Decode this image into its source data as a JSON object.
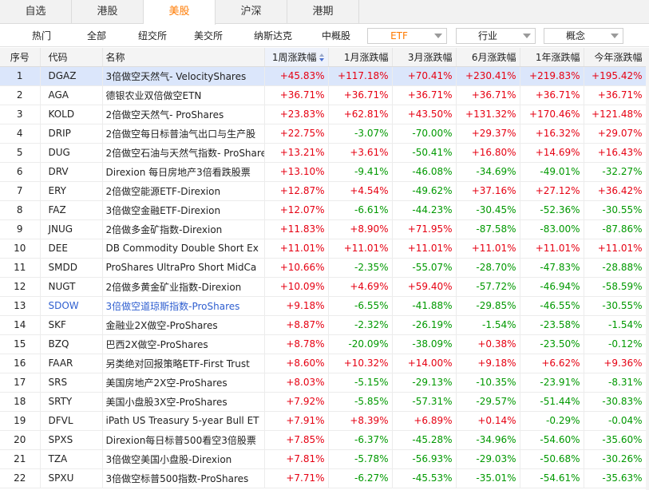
{
  "market_tabs": [
    {
      "label": "自选",
      "active": false
    },
    {
      "label": "港股",
      "active": false
    },
    {
      "label": "美股",
      "active": true
    },
    {
      "label": "沪深",
      "active": false
    },
    {
      "label": "港期",
      "active": false
    }
  ],
  "categories": [
    "热门",
    "全部",
    "纽交所",
    "美交所",
    "纳斯达克",
    "中概股"
  ],
  "dropdowns": {
    "etf": "ETF",
    "industry": "行业",
    "concept": "概念"
  },
  "columns": {
    "idx": "序号",
    "code": "代码",
    "name": "名称",
    "w1": "1周涨跌幅",
    "m1": "1月涨跌幅",
    "m3": "3月涨跌幅",
    "m6": "6月涨跌幅",
    "y1": "1年涨跌幅",
    "ytd": "今年涨跌幅"
  },
  "colors": {
    "up": "#e60012",
    "down": "#009900",
    "accent": "#ff7a00",
    "link": "#2f5fd0",
    "selected_row": "#dbe6fb"
  },
  "rows": [
    {
      "idx": "1",
      "code": "DGAZ",
      "name": "3倍做空天然气- VelocityShares",
      "w1": "+45.83%",
      "m1": "+117.18%",
      "m3": "+70.41%",
      "m6": "+230.41%",
      "y1": "+219.83%",
      "ytd": "+195.42%",
      "selected": true
    },
    {
      "idx": "2",
      "code": "AGA",
      "name": "德银农业双倍做空ETN",
      "w1": "+36.71%",
      "m1": "+36.71%",
      "m3": "+36.71%",
      "m6": "+36.71%",
      "y1": "+36.71%",
      "ytd": "+36.71%"
    },
    {
      "idx": "3",
      "code": "KOLD",
      "name": "2倍做空天然气- ProShares",
      "w1": "+23.83%",
      "m1": "+62.81%",
      "m3": "+43.50%",
      "m6": "+131.32%",
      "y1": "+170.46%",
      "ytd": "+121.48%"
    },
    {
      "idx": "4",
      "code": "DRIP",
      "name": "2倍做空每日标普油气出口与生产股",
      "w1": "+22.75%",
      "m1": "-3.07%",
      "m3": "-70.00%",
      "m6": "+29.37%",
      "y1": "+16.32%",
      "ytd": "+29.07%"
    },
    {
      "idx": "5",
      "code": "DUG",
      "name": "2倍做空石油与天然气指数- ProShares",
      "w1": "+13.21%",
      "m1": "+3.61%",
      "m3": "-50.41%",
      "m6": "+16.80%",
      "y1": "+14.69%",
      "ytd": "+16.43%"
    },
    {
      "idx": "6",
      "code": "DRV",
      "name": "Direxion 每日房地产3倍看跌股票",
      "w1": "+13.10%",
      "m1": "-9.41%",
      "m3": "-46.08%",
      "m6": "-34.69%",
      "y1": "-49.01%",
      "ytd": "-32.27%"
    },
    {
      "idx": "7",
      "code": "ERY",
      "name": "2倍做空能源ETF-Direxion",
      "w1": "+12.87%",
      "m1": "+4.54%",
      "m3": "-49.62%",
      "m6": "+37.16%",
      "y1": "+27.12%",
      "ytd": "+36.42%"
    },
    {
      "idx": "8",
      "code": "FAZ",
      "name": "3倍做空金融ETF-Direxion",
      "w1": "+12.07%",
      "m1": "-6.61%",
      "m3": "-44.23%",
      "m6": "-30.45%",
      "y1": "-52.36%",
      "ytd": "-30.55%"
    },
    {
      "idx": "9",
      "code": "JNUG",
      "name": "2倍做多金矿指数-Direxion",
      "w1": "+11.83%",
      "m1": "+8.90%",
      "m3": "+71.95%",
      "m6": "-87.58%",
      "y1": "-83.00%",
      "ytd": "-87.86%"
    },
    {
      "idx": "10",
      "code": "DEE",
      "name": "DB Commodity Double Short Ex",
      "w1": "+11.01%",
      "m1": "+11.01%",
      "m3": "+11.01%",
      "m6": "+11.01%",
      "y1": "+11.01%",
      "ytd": "+11.01%"
    },
    {
      "idx": "11",
      "code": "SMDD",
      "name": "ProShares UltraPro Short MidCa",
      "w1": "+10.66%",
      "m1": "-2.35%",
      "m3": "-55.07%",
      "m6": "-28.70%",
      "y1": "-47.83%",
      "ytd": "-28.88%"
    },
    {
      "idx": "12",
      "code": "NUGT",
      "name": "2倍做多黄金矿业指数-Direxion",
      "w1": "+10.09%",
      "m1": "+4.69%",
      "m3": "+59.40%",
      "m6": "-57.72%",
      "y1": "-46.94%",
      "ytd": "-58.59%"
    },
    {
      "idx": "13",
      "code": "SDOW",
      "name": "3倍做空道琼斯指数-ProShares",
      "w1": "+9.18%",
      "m1": "-6.55%",
      "m3": "-41.88%",
      "m6": "-29.85%",
      "y1": "-46.55%",
      "ytd": "-30.55%",
      "link": true
    },
    {
      "idx": "14",
      "code": "SKF",
      "name": "金融业2X做空-ProShares",
      "w1": "+8.87%",
      "m1": "-2.32%",
      "m3": "-26.19%",
      "m6": "-1.54%",
      "y1": "-23.58%",
      "ytd": "-1.54%"
    },
    {
      "idx": "15",
      "code": "BZQ",
      "name": "巴西2X做空-ProShares",
      "w1": "+8.78%",
      "m1": "-20.09%",
      "m3": "-38.09%",
      "m6": "+0.38%",
      "y1": "-23.50%",
      "ytd": "-0.12%"
    },
    {
      "idx": "16",
      "code": "FAAR",
      "name": "另类绝对回报策略ETF-First Trust",
      "w1": "+8.60%",
      "m1": "+10.32%",
      "m3": "+14.00%",
      "m6": "+9.18%",
      "y1": "+6.62%",
      "ytd": "+9.36%"
    },
    {
      "idx": "17",
      "code": "SRS",
      "name": "美国房地产2X空-ProShares",
      "w1": "+8.03%",
      "m1": "-5.15%",
      "m3": "-29.13%",
      "m6": "-10.35%",
      "y1": "-23.91%",
      "ytd": "-8.31%"
    },
    {
      "idx": "18",
      "code": "SRTY",
      "name": "美国小盘股3X空-ProShares",
      "w1": "+7.92%",
      "m1": "-5.85%",
      "m3": "-57.31%",
      "m6": "-29.57%",
      "y1": "-51.44%",
      "ytd": "-30.83%"
    },
    {
      "idx": "19",
      "code": "DFVL",
      "name": "iPath US Treasury 5-year Bull ET",
      "w1": "+7.91%",
      "m1": "+8.39%",
      "m3": "+6.89%",
      "m6": "+0.14%",
      "y1": "-0.29%",
      "ytd": "-0.04%"
    },
    {
      "idx": "20",
      "code": "SPXS",
      "name": "Direxion每日标普500看空3倍股票",
      "w1": "+7.85%",
      "m1": "-6.37%",
      "m3": "-45.28%",
      "m6": "-34.96%",
      "y1": "-54.60%",
      "ytd": "-35.60%"
    },
    {
      "idx": "21",
      "code": "TZA",
      "name": "3倍做空美国小盘股-Direxion",
      "w1": "+7.81%",
      "m1": "-5.78%",
      "m3": "-56.93%",
      "m6": "-29.03%",
      "y1": "-50.68%",
      "ytd": "-30.26%"
    },
    {
      "idx": "22",
      "code": "SPXU",
      "name": "3倍做空标普500指数-ProShares",
      "w1": "+7.71%",
      "m1": "-6.27%",
      "m3": "-45.53%",
      "m6": "-35.01%",
      "y1": "-54.61%",
      "ytd": "-35.63%"
    }
  ]
}
